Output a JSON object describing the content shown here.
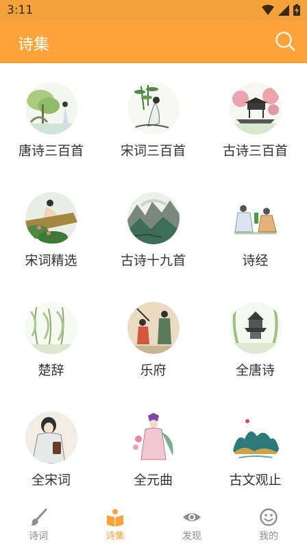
{
  "status": {
    "time": "3:11"
  },
  "appbar": {
    "title": "诗集"
  },
  "collections": [
    {
      "label": "唐诗三百首"
    },
    {
      "label": "宋词三百首"
    },
    {
      "label": "古诗三百首"
    },
    {
      "label": "宋词精选"
    },
    {
      "label": "古诗十九首"
    },
    {
      "label": "诗经"
    },
    {
      "label": "楚辞"
    },
    {
      "label": "乐府"
    },
    {
      "label": "全唐诗"
    },
    {
      "label": "全宋词"
    },
    {
      "label": "全元曲"
    },
    {
      "label": "古文观止"
    }
  ],
  "tabs": [
    {
      "label": "诗词",
      "icon": "brush-icon"
    },
    {
      "label": "诗集",
      "icon": "book-icon",
      "active": true
    },
    {
      "label": "发现",
      "icon": "eye-icon"
    },
    {
      "label": "我的",
      "icon": "smiley-icon"
    }
  ],
  "colors": {
    "accent": "#ffa33a",
    "statusbar": "#f3a13a",
    "inactive": "#8e8e8e"
  }
}
